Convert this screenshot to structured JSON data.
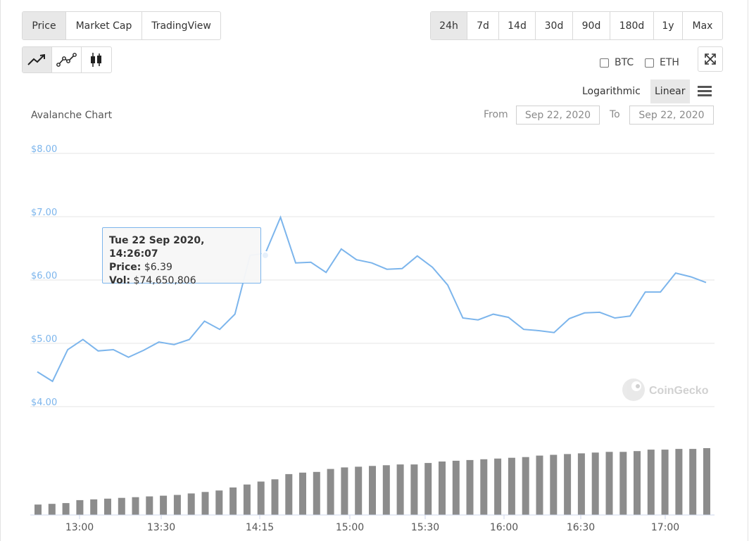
{
  "tabs": [
    "Price",
    "Market Cap",
    "TradingView"
  ],
  "active_tab": 0,
  "ranges": [
    "24h",
    "7d",
    "14d",
    "30d",
    "90d",
    "180d",
    "1y",
    "Max"
  ],
  "active_range": 0,
  "chart_types": [
    "line-chart-icon",
    "line-markers-icon",
    "candlestick-icon"
  ],
  "compare": {
    "btc": "BTC",
    "eth": "ETH"
  },
  "scale": {
    "log": "Logarithmic",
    "linear": "Linear"
  },
  "date_range": {
    "from_label": "From",
    "from_value": "Sep 22, 2020",
    "to_label": "To",
    "to_value": "Sep 22, 2020"
  },
  "tooltip": {
    "title": "Tue 22 Sep 2020, 14:26:07",
    "price_label": "Price:",
    "price_value": "$6.39",
    "vol_label": "Vol:",
    "vol_value": "$74,650,806"
  },
  "watermark": "CoinGecko",
  "colors": {
    "line": "#7cb5ec",
    "volume": "#8c8c8c",
    "axis_text": "#7cb5ec"
  },
  "chart_data": {
    "type": "line",
    "title": "Avalanche Chart",
    "y_ticks": [
      "$4.00",
      "$5.00",
      "$6.00",
      "$7.00",
      "$8.00"
    ],
    "ylim": [
      4,
      8
    ],
    "x_ticks": [
      "13:00",
      "13:30",
      "14:15",
      "15:00",
      "15:30",
      "16:00",
      "16:30",
      "17:00"
    ],
    "x_tick_minutes": [
      780,
      810,
      855,
      900,
      930,
      960,
      990,
      1020
    ],
    "xlim_minutes": [
      762,
      1028
    ],
    "series": [
      {
        "x_minutes": [
          764,
          772,
          780,
          788,
          795,
          803,
          811,
          819,
          826,
          834,
          842,
          850,
          857,
          865,
          873,
          880,
          888,
          896,
          903,
          911,
          918,
          926,
          934,
          941,
          949,
          957,
          964,
          972,
          979,
          987,
          994,
          1002,
          1010,
          1017,
          1026
        ],
        "values": [
          4.55,
          4.4,
          4.9,
          5.06,
          4.88,
          4.9,
          4.78,
          4.89,
          5.02,
          4.98,
          5.06,
          5.35,
          5.22,
          5.46,
          6.39,
          6.42,
          6.99,
          6.27,
          6.28,
          6.12,
          6.49,
          6.32,
          6.27,
          6.17,
          6.18,
          6.38,
          6.2,
          5.92,
          5.4,
          5.37,
          5.46,
          5.41,
          5.22,
          5.2,
          5.17,
          5.39,
          5.48,
          5.49,
          5.4,
          5.43,
          5.81,
          5.81,
          6.11,
          6.05,
          5.96
        ]
      }
    ],
    "volume": [
      14,
      15,
      16,
      20,
      21,
      22,
      23,
      24,
      25,
      26,
      27,
      29,
      31,
      33,
      37,
      41,
      45,
      48,
      55,
      57,
      58,
      62,
      64,
      65,
      66,
      67,
      68,
      68,
      70,
      72,
      73,
      74,
      75,
      76,
      77,
      78,
      80,
      81,
      82,
      83,
      84,
      85,
      85,
      86,
      88,
      88,
      89,
      89,
      90
    ]
  }
}
